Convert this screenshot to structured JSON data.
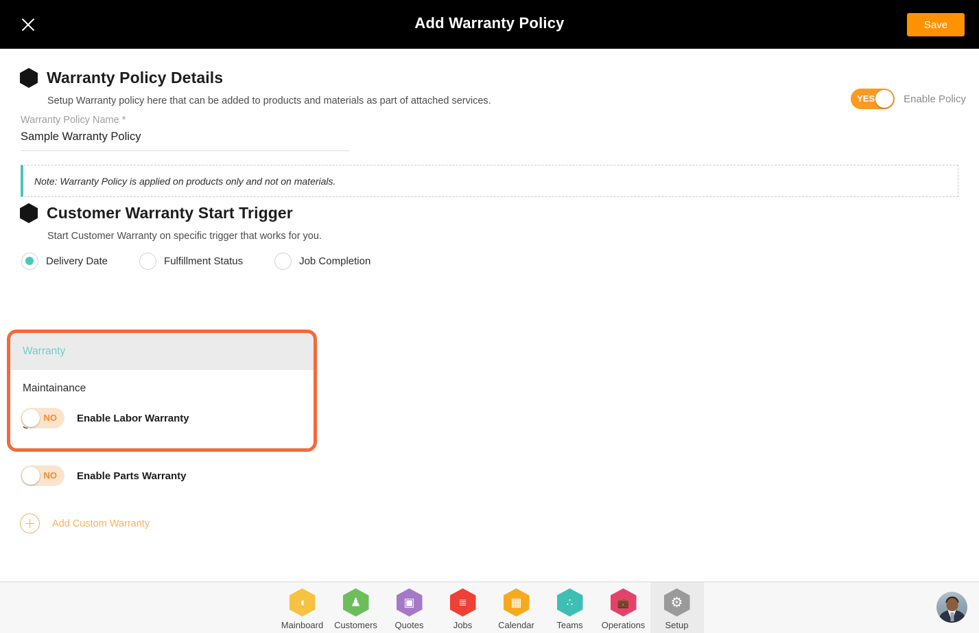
{
  "header": {
    "title": "Add Warranty Policy",
    "close_icon": "close-icon",
    "save_label": "Save",
    "accent_orange": "#FF9200",
    "background": "#000000"
  },
  "details_section": {
    "title": "Warranty Policy Details",
    "subtitle": "Setup Warranty policy here that can be added to products and materials as part of attached services.",
    "enable_policy": {
      "label": "Enable Policy",
      "state": "YES",
      "on": true,
      "color_on": "#FB9921"
    },
    "policy_name_field": {
      "label": "Warranty Policy Name *",
      "value": "Sample Warranty Policy",
      "placeholder": "Warranty Policy Name"
    },
    "note": {
      "text": "Note: Warranty Policy is applied on products only and not on materials.",
      "accent_color": "#4FC3BD"
    }
  },
  "trigger_section": {
    "title": "Customer Warranty Start Trigger",
    "subtitle": "Start Customer Warranty on specific trigger that works for you.",
    "radio_color": "#48C9B8",
    "options": [
      {
        "label": "Delivery Date",
        "selected": true
      },
      {
        "label": "Fulfillment Status",
        "selected": false
      },
      {
        "label": "Job Completion",
        "selected": false
      }
    ]
  },
  "dropdown": {
    "highlight_color": "#F4693B",
    "selected_text_color": "#6FCFC6",
    "items": [
      {
        "label": "Warranty",
        "highlighted": true
      },
      {
        "label": "Maintainance",
        "highlighted": false
      },
      {
        "label": "SLA",
        "highlighted": false
      }
    ]
  },
  "warranty_toggles": [
    {
      "label": "Enable Labor Warranty",
      "state": "NO",
      "on": false
    },
    {
      "label": "Enable Parts Warranty",
      "state": "NO",
      "on": false
    }
  ],
  "add_custom": {
    "label": "Add Custom Warranty",
    "icon": "plus-circle-icon",
    "color": "#FBAF5C"
  },
  "bottom_nav": {
    "items": [
      {
        "label": "Mainboard",
        "icon": "mainboard-icon",
        "color": "#F5C242",
        "glyph": "◗",
        "active": false
      },
      {
        "label": "Customers",
        "icon": "customers-icon",
        "color": "#6CBE5B",
        "glyph": "●",
        "active": false
      },
      {
        "label": "Quotes",
        "icon": "quotes-icon",
        "color": "#A678C8",
        "glyph": "▤",
        "active": false
      },
      {
        "label": "Jobs",
        "icon": "jobs-icon",
        "color": "#EE4036",
        "glyph": "≣",
        "active": false
      },
      {
        "label": "Calendar",
        "icon": "calendar-icon",
        "color": "#F5AA1E",
        "glyph": "▦",
        "active": false
      },
      {
        "label": "Teams",
        "icon": "teams-icon",
        "color": "#3FBFB4",
        "glyph": "∴",
        "active": false
      },
      {
        "label": "Operations",
        "icon": "operations-icon",
        "color": "#E3436B",
        "glyph": "▬",
        "active": false
      },
      {
        "label": "Setup",
        "icon": "gear-icon",
        "color": "#9A9A9A",
        "glyph": "⚙",
        "active": true
      }
    ],
    "avatar": "user-avatar"
  }
}
